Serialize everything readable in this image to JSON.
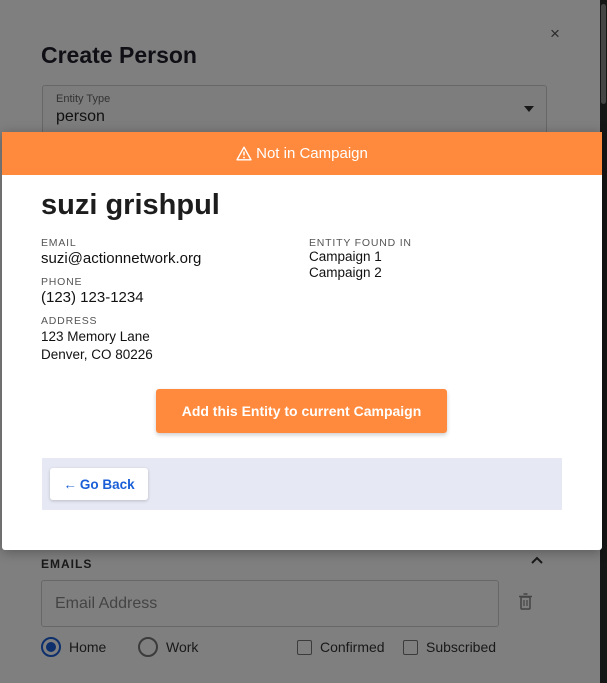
{
  "background_dialog": {
    "title": "Create Person",
    "entity_type": {
      "label": "Entity Type",
      "value": "person"
    },
    "close_symbol": "×",
    "emails_section": {
      "title": "EMAILS",
      "input_placeholder": "Email Address",
      "radio_options": [
        {
          "label": "Home",
          "selected": true
        },
        {
          "label": "Work",
          "selected": false
        }
      ],
      "checkboxes": [
        {
          "label": "Confirmed",
          "checked": false
        },
        {
          "label": "Subscribed",
          "checked": false
        }
      ]
    }
  },
  "modal": {
    "banner_text": "Not in Campaign",
    "person_name": "suzi grishpul",
    "email": {
      "label": "EMAIL",
      "value": "suzi@actionnetwork.org"
    },
    "phone": {
      "label": "PHONE",
      "value": "(123) 123-1234"
    },
    "address": {
      "label": "ADDRESS",
      "line1": "123 Memory Lane",
      "line2": "Denver, CO 80226"
    },
    "entity_found_in": {
      "label": "ENTITY FOUND IN",
      "campaigns": [
        "Campaign 1",
        "Campaign 2"
      ]
    },
    "add_button_label": "Add this Entity to current Campaign",
    "back_button": {
      "arrow": "←",
      "label": "Go Back"
    }
  },
  "colors": {
    "accent_orange": "#ff8a3d",
    "link_blue": "#1a5fd8",
    "footer_bg": "#e6e9f4"
  },
  "icons": [
    "close-icon",
    "chevron-down-icon",
    "chevron-up-icon",
    "trash-icon",
    "warning-icon",
    "arrow-left-icon"
  ]
}
